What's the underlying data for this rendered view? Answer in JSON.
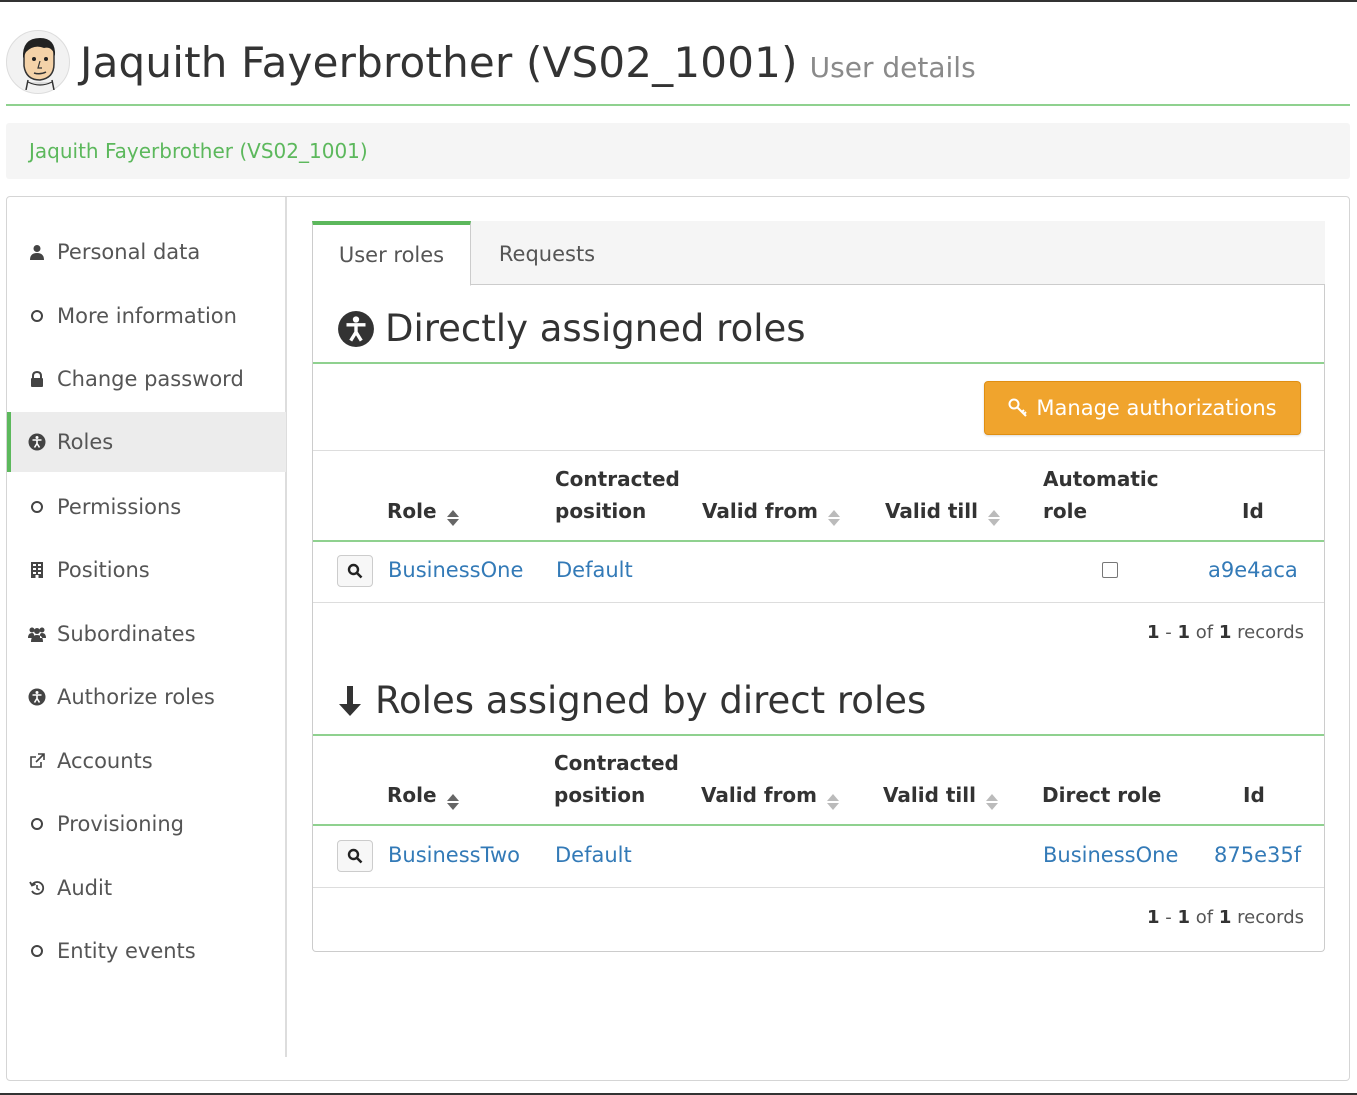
{
  "header": {
    "title": "Jaquith Fayerbrother (VS02_1001)",
    "subtitle": "User details"
  },
  "breadcrumb": {
    "current": "Jaquith Fayerbrother (VS02_1001)"
  },
  "sidebar": {
    "items": [
      {
        "label": "Personal data",
        "icon": "user-icon"
      },
      {
        "label": "More information",
        "icon": "circle-icon"
      },
      {
        "label": "Change password",
        "icon": "lock-icon"
      },
      {
        "label": "Roles",
        "icon": "accessibility-icon",
        "active": true
      },
      {
        "label": "Permissions",
        "icon": "circle-icon"
      },
      {
        "label": "Positions",
        "icon": "building-icon"
      },
      {
        "label": "Subordinates",
        "icon": "users-icon"
      },
      {
        "label": "Authorize roles",
        "icon": "accessibility-icon"
      },
      {
        "label": "Accounts",
        "icon": "external-link-icon"
      },
      {
        "label": "Provisioning",
        "icon": "circle-icon"
      },
      {
        "label": "Audit",
        "icon": "history-icon"
      },
      {
        "label": "Entity events",
        "icon": "circle-icon"
      }
    ]
  },
  "tabs": [
    {
      "label": "User roles",
      "active": true
    },
    {
      "label": "Requests"
    }
  ],
  "direct_roles": {
    "title": "Directly assigned roles",
    "manage_button": "Manage authorizations",
    "columns": {
      "role": "Role",
      "contracted_line1": "Contracted",
      "contracted_line2": "position",
      "valid_from": "Valid from",
      "valid_till": "Valid till",
      "automatic_line1": "Automatic",
      "automatic_line2": "role",
      "id": "Id"
    },
    "rows": [
      {
        "role": "BusinessOne",
        "contracted_position": "Default",
        "valid_from": "",
        "valid_till": "",
        "automatic_role": false,
        "id": "a9e4aca"
      }
    ],
    "pagination": {
      "from": "1",
      "to": "1",
      "of_text": "of",
      "total": "1",
      "records_text": "records",
      "sep": "-"
    }
  },
  "indirect_roles": {
    "title": "Roles assigned by direct roles",
    "columns": {
      "role": "Role",
      "contracted_line1": "Contracted",
      "contracted_line2": "position",
      "valid_from": "Valid from",
      "valid_till": "Valid till",
      "direct_role": "Direct role",
      "id": "Id"
    },
    "rows": [
      {
        "role": "BusinessTwo",
        "contracted_position": "Default",
        "valid_from": "",
        "valid_till": "",
        "direct_role": "BusinessOne",
        "id": "875e35f"
      }
    ],
    "pagination": {
      "from": "1",
      "to": "1",
      "of_text": "of",
      "total": "1",
      "records_text": "records",
      "sep": "-"
    }
  },
  "colors": {
    "accent_green": "#5cb85c",
    "link_blue": "#337ab7",
    "warning_orange": "#f0a42d"
  }
}
